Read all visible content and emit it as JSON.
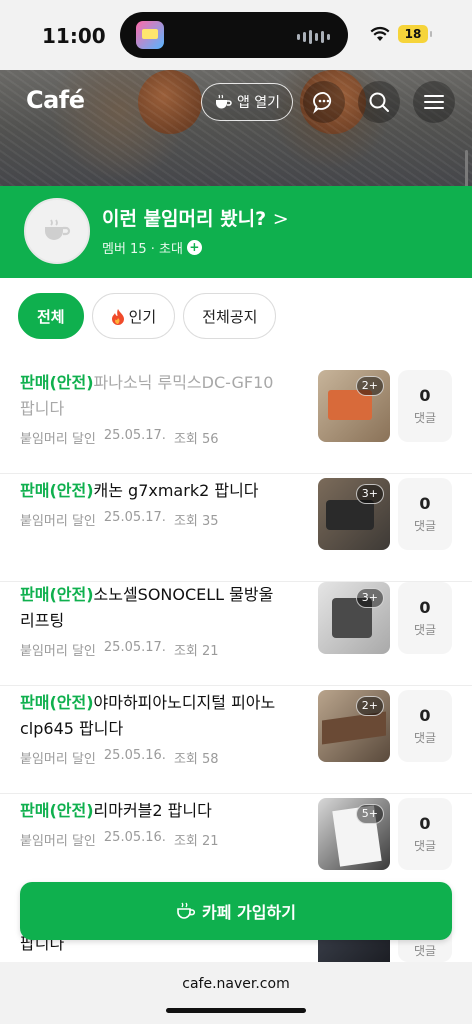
{
  "status_bar": {
    "time": "11:00",
    "battery": "18"
  },
  "header": {
    "logo": "Café",
    "app_open_label": "앱 열기"
  },
  "cafe": {
    "name": "이런 붙임머리 봤니?",
    "name_arrow": ">",
    "member_line": "멤버 15 · 초대"
  },
  "tabs": [
    {
      "label": "전체",
      "active": true
    },
    {
      "label": "인기",
      "active": false
    },
    {
      "label": "전체공지",
      "active": false
    }
  ],
  "posts": [
    {
      "tag": "판매(안전)",
      "title": "파나소닉 루믹스DC-GF10 팝니다",
      "author": "붙임머리 달인",
      "date": "25.05.17.",
      "views": "조회 56",
      "thumb_count": "2+",
      "comments": "0",
      "comment_label": "댓글"
    },
    {
      "tag": "판매(안전)",
      "title": "캐논 g7xmark2 팝니다",
      "author": "붙임머리 달인",
      "date": "25.05.17.",
      "views": "조회 35",
      "thumb_count": "3+",
      "comments": "0",
      "comment_label": "댓글"
    },
    {
      "tag": "판매(안전)",
      "title": "소노셀SONOCELL 물방울 리프팅",
      "author": "붙임머리 달인",
      "date": "25.05.17.",
      "views": "조회 21",
      "thumb_count": "3+",
      "comments": "0",
      "comment_label": "댓글"
    },
    {
      "tag": "판매(안전)",
      "title": "야마하피아노디지털 피아노 clp645 팝니다",
      "author": "붙임머리 달인",
      "date": "25.05.16.",
      "views": "조회 58",
      "thumb_count": "2+",
      "comments": "0",
      "comment_label": "댓글"
    },
    {
      "tag": "판매(안전)",
      "title": "리마커블2 팝니다",
      "author": "붙임머리 달인",
      "date": "25.05.16.",
      "views": "조회 21",
      "thumb_count": "5+",
      "comments": "0",
      "comment_label": "댓글"
    }
  ],
  "join_button": {
    "label": "카페 가입하기"
  },
  "partial_post": {
    "title": "팝니다",
    "comment_label": "댓글"
  },
  "browser": {
    "url": "cafe.naver.com"
  },
  "colors": {
    "brand_green": "#0fb04e",
    "dim_title": "#a8a8a8"
  },
  "icons": [
    "wifi-icon",
    "coffee-cup-icon",
    "chat-bubble-icon",
    "search-icon",
    "hamburger-menu-icon",
    "fire-icon",
    "plus-icon"
  ]
}
